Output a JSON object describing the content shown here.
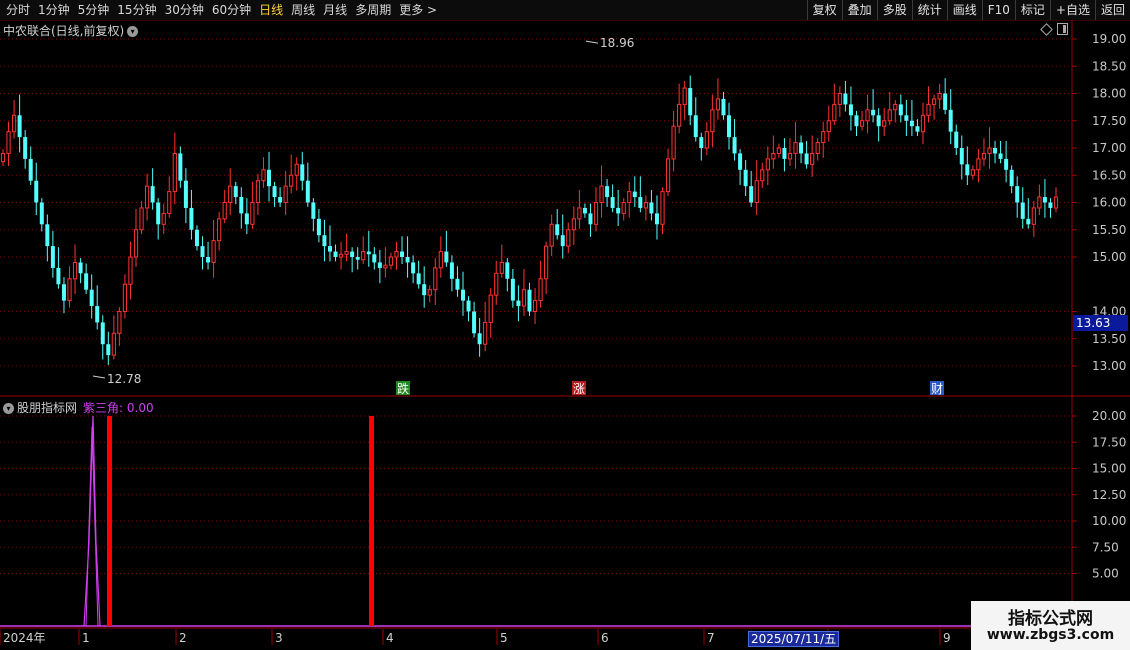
{
  "toolbar": {
    "periods": [
      "分时",
      "1分钟",
      "5分钟",
      "15分钟",
      "30分钟",
      "60分钟",
      "日线",
      "周线",
      "月线",
      "多周期",
      "更多 >"
    ],
    "active_period": "日线",
    "buttons": [
      "复权",
      "叠加",
      "多股",
      "统计",
      "画线",
      "F10",
      "标记",
      "+自选",
      "返回"
    ]
  },
  "main_chart": {
    "title": "中农联合(日线,前复权)",
    "current_price_label": "13.63",
    "high_annotation": "18.96",
    "low_annotation": "12.78",
    "event_markers": [
      {
        "text": "跌",
        "bg": "#1c8a1c"
      },
      {
        "text": "涨",
        "bg": "#b81c1c"
      },
      {
        "text": "财",
        "bg": "#2a5ac8"
      }
    ]
  },
  "indicator": {
    "name": "股朋指标网",
    "series_label": "紫三角: 0.00"
  },
  "time_axis": {
    "labels": [
      "2024年",
      "1",
      "2",
      "3",
      "4",
      "5",
      "6",
      "7",
      "8",
      "9"
    ],
    "cursor_date": "2025/07/11/五"
  },
  "watermark": {
    "title": "指标公式网",
    "url": "www.zbgs3.com"
  },
  "colors": {
    "up": "#ff3232",
    "down": "#54ffff",
    "grid": "#8a0000",
    "axis": "#a00000",
    "purple": "#d040f0",
    "signal_bar": "#ff0000"
  },
  "chart_data": [
    {
      "type": "candlestick",
      "title": "中农联合(日线,前复权)",
      "ylim": [
        12.6,
        19.25
      ],
      "yticks": [
        "19.00",
        "18.50",
        "18.00",
        "17.50",
        "17.00",
        "16.50",
        "16.00",
        "15.50",
        "15.00",
        "14.00",
        "13.50",
        "13.00"
      ],
      "close_series": [
        16.9,
        17.3,
        17.6,
        17.2,
        16.8,
        16.4,
        16.0,
        15.6,
        15.2,
        14.8,
        14.5,
        14.2,
        14.6,
        14.9,
        14.7,
        14.4,
        14.1,
        13.8,
        13.4,
        13.2,
        13.6,
        14.0,
        14.5,
        15.0,
        15.5,
        15.9,
        16.3,
        16.0,
        15.6,
        15.8,
        16.2,
        16.9,
        16.4,
        15.9,
        15.5,
        15.2,
        15.0,
        14.9,
        15.3,
        15.7,
        16.0,
        16.3,
        16.1,
        15.8,
        15.6,
        16.0,
        16.4,
        16.6,
        16.3,
        16.1,
        16.0,
        16.3,
        16.5,
        16.7,
        16.4,
        16.0,
        15.7,
        15.4,
        15.2,
        15.1,
        15.0,
        15.05,
        15.1,
        15.0,
        14.95,
        15.1,
        15.05,
        14.9,
        14.8,
        14.85,
        15.0,
        15.1,
        15.0,
        14.9,
        14.7,
        14.5,
        14.3,
        14.4,
        14.8,
        15.1,
        14.9,
        14.6,
        14.4,
        14.2,
        14.0,
        13.6,
        13.4,
        13.8,
        14.3,
        14.7,
        14.9,
        14.6,
        14.2,
        14.1,
        14.4,
        14.0,
        14.2,
        14.6,
        15.2,
        15.6,
        15.4,
        15.2,
        15.5,
        15.7,
        15.9,
        15.8,
        15.6,
        16.0,
        16.3,
        16.1,
        15.9,
        15.8,
        16.0,
        16.2,
        16.1,
        15.9,
        16.0,
        15.8,
        15.6,
        16.2,
        16.8,
        17.4,
        17.8,
        18.1,
        17.6,
        17.2,
        17.0,
        17.3,
        17.7,
        17.9,
        17.6,
        17.2,
        16.9,
        16.6,
        16.3,
        16.0,
        16.4,
        16.6,
        16.8,
        16.9,
        17.0,
        16.8,
        16.9,
        17.1,
        16.9,
        16.7,
        16.9,
        17.1,
        17.3,
        17.5,
        17.8,
        18.0,
        17.8,
        17.6,
        17.4,
        17.5,
        17.7,
        17.6,
        17.4,
        17.5,
        17.7,
        17.8,
        17.6,
        17.5,
        17.4,
        17.3,
        17.6,
        17.8,
        17.9,
        18.0,
        17.7,
        17.3,
        17.0,
        16.7,
        16.5,
        16.6,
        16.8,
        16.9,
        17.0,
        16.9,
        16.8,
        16.6,
        16.3,
        16.0,
        15.7,
        15.6,
        15.9,
        16.1,
        16.0,
        15.9,
        16.1
      ],
      "high": 18.96,
      "low": 12.78,
      "last": 13.63
    },
    {
      "type": "bar",
      "title": "股朋指标网",
      "series": [
        {
          "name": "紫三角",
          "values": [
            0.0
          ]
        }
      ],
      "ylim": [
        0,
        21.5
      ],
      "yticks": [
        "20.00",
        "17.50",
        "15.00",
        "12.50",
        "10.00",
        "7.50",
        "5.00"
      ],
      "signal_bars": [
        20,
        20
      ],
      "purple_spike_peak": 20
    }
  ]
}
